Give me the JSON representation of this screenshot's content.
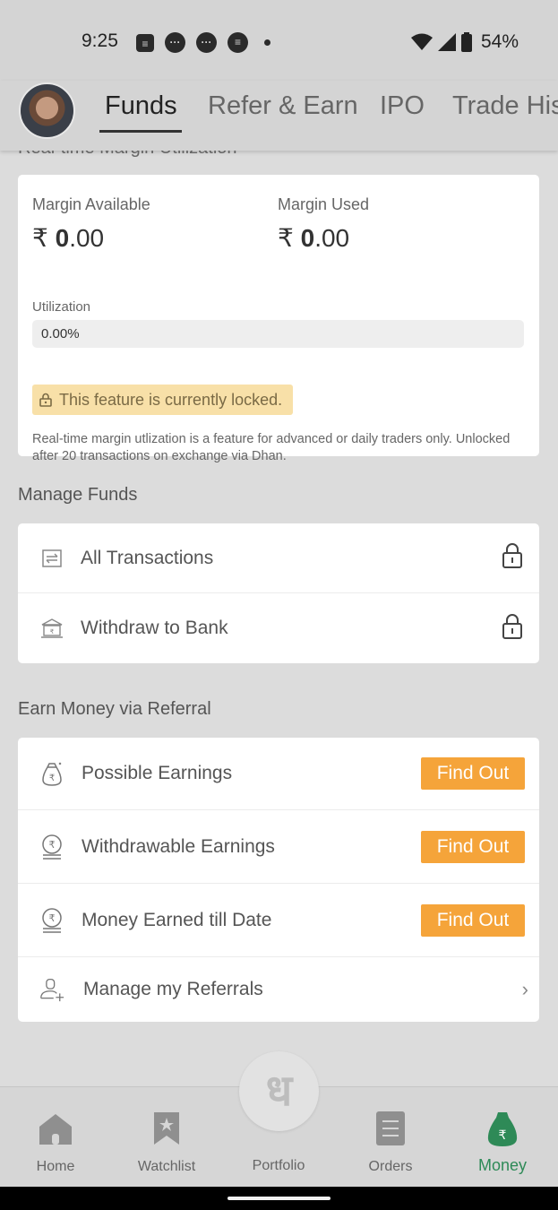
{
  "status_bar": {
    "time": "9:25",
    "battery": "54%",
    "notification_icons": [
      "news-icon",
      "chat-bubble-icon",
      "chat-bubble-icon",
      "bug-icon",
      "more-dot-icon"
    ]
  },
  "tabs": [
    {
      "label": "Funds",
      "active": true
    },
    {
      "label": "Refer & Earn",
      "active": false
    },
    {
      "label": "IPO",
      "active": false
    },
    {
      "label": "Trade His",
      "active": false
    }
  ],
  "margin_section": {
    "heading": "Real-time Margin Utilization",
    "available_label": "Margin Available",
    "available_currency": "₹",
    "available_whole": "0",
    "available_decimal": ".00",
    "used_label": "Margin Used",
    "used_currency": "₹",
    "used_whole": "0",
    "used_decimal": ".00",
    "utilization_label": "Utilization",
    "utilization_value": "0.00%",
    "utilization_fraction": 0.0,
    "locked_text": "This feature is currently locked.",
    "locked_description": "Real-time margin utlization is a feature for advanced or daily traders only. Unlocked after 20 transactions on exchange via Dhan."
  },
  "manage_funds": {
    "title": "Manage Funds",
    "items": [
      {
        "label": "All Transactions",
        "icon": "transfer-icon"
      },
      {
        "label": "Withdraw to Bank",
        "icon": "bank-icon"
      }
    ]
  },
  "referral": {
    "title": "Earn Money via Referral",
    "items": [
      {
        "label": "Possible Earnings",
        "button": "Find Out",
        "icon": "money-bag-icon"
      },
      {
        "label": "Withdrawable Earnings",
        "button": "Find Out",
        "icon": "coin-stack-icon"
      },
      {
        "label": "Money Earned till Date",
        "button": "Find Out",
        "icon": "coin-stack-icon"
      },
      {
        "label": "Manage my Referrals",
        "icon": "add-user-icon"
      }
    ]
  },
  "bottom_nav": {
    "items": [
      {
        "label": "Home",
        "icon": "home-icon",
        "active": false
      },
      {
        "label": "Watchlist",
        "icon": "bookmark-star-icon",
        "active": false
      },
      {
        "label": "Portfolio",
        "icon": "dhan-logo-icon",
        "active": false
      },
      {
        "label": "Orders",
        "icon": "list-icon",
        "active": false
      },
      {
        "label": "Money",
        "icon": "money-bag-icon",
        "active": true
      }
    ],
    "portfolio_glyph": "ध"
  },
  "colors": {
    "accent_orange": "#f5a43a",
    "active_green": "#2e8a57",
    "locked_badge_bg": "#f8e0a8"
  }
}
